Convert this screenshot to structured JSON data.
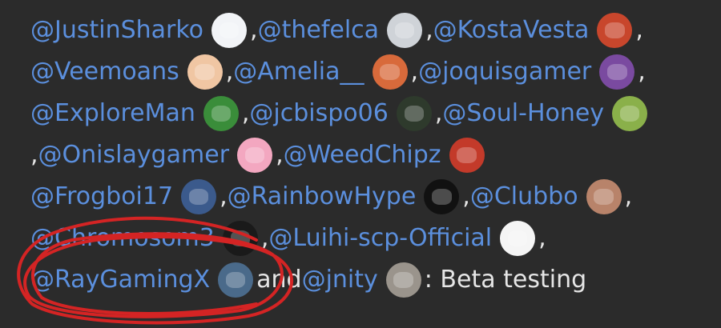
{
  "lines": [
    [
      {
        "type": "mention",
        "text": "@JustinSharko"
      },
      {
        "type": "avatar",
        "name": "avatar-justinsharko",
        "color": "#f2f4f7"
      },
      {
        "type": "sep",
        "text": ", "
      },
      {
        "type": "mention",
        "text": "@thefelca"
      },
      {
        "type": "avatar",
        "name": "avatar-thefelca",
        "color": "#cfd3d8"
      },
      {
        "type": "sep",
        "text": ", "
      },
      {
        "type": "mention",
        "text": "@KostaVesta"
      },
      {
        "type": "avatar",
        "name": "avatar-kostavesta",
        "color": "#c8462c"
      },
      {
        "type": "sep",
        "text": ","
      }
    ],
    [
      {
        "type": "mention",
        "text": "@Veemoans"
      },
      {
        "type": "avatar",
        "name": "avatar-veemoans",
        "color": "#f0c6a3"
      },
      {
        "type": "sep",
        "text": ", "
      },
      {
        "type": "mention",
        "text": "@Amelia__"
      },
      {
        "type": "avatar",
        "name": "avatar-amelia",
        "color": "#d86a3b"
      },
      {
        "type": "sep",
        "text": ", "
      },
      {
        "type": "mention",
        "text": "@joquisgamer"
      },
      {
        "type": "avatar",
        "name": "avatar-joquisgamer",
        "color": "#7a4aa0"
      },
      {
        "type": "sep",
        "text": ","
      }
    ],
    [
      {
        "type": "mention",
        "text": "@ExploreMan"
      },
      {
        "type": "avatar",
        "name": "avatar-exploreman",
        "color": "#3a8d3a"
      },
      {
        "type": "sep",
        "text": ", "
      },
      {
        "type": "mention",
        "text": "@jcbispo06"
      },
      {
        "type": "avatar",
        "name": "avatar-jcbispo06",
        "color": "#2e3a2c"
      },
      {
        "type": "sep",
        "text": ", "
      },
      {
        "type": "mention",
        "text": "@Soul-Honey"
      },
      {
        "type": "avatar",
        "name": "avatar-soul-honey",
        "color": "#8ab04a"
      }
    ],
    [
      {
        "type": "sep",
        "text": ", "
      },
      {
        "type": "mention",
        "text": "@Onislaygamer"
      },
      {
        "type": "avatar",
        "name": "avatar-onislaygamer",
        "color": "#f3a7c0"
      },
      {
        "type": "sep",
        "text": ", "
      },
      {
        "type": "mention",
        "text": "@WeedChipz"
      },
      {
        "type": "avatar",
        "name": "avatar-weedchipz",
        "color": "#c33a2a"
      }
    ],
    [
      {
        "type": "mention",
        "text": "@Frogboi17"
      },
      {
        "type": "avatar",
        "name": "avatar-frogboi17",
        "color": "#3b5a8c"
      },
      {
        "type": "sep",
        "text": ", "
      },
      {
        "type": "mention",
        "text": "@RainbowHype"
      },
      {
        "type": "avatar",
        "name": "avatar-rainbowhype",
        "color": "#111111"
      },
      {
        "type": "sep",
        "text": ", "
      },
      {
        "type": "mention",
        "text": "@Clubbo"
      },
      {
        "type": "avatar",
        "name": "avatar-clubbo",
        "color": "#b8836a"
      },
      {
        "type": "sep",
        "text": ","
      }
    ],
    [
      {
        "type": "mention",
        "text": "@Chromosom3"
      },
      {
        "type": "avatar",
        "name": "avatar-chromosom3",
        "color": "#1a1a1a"
      },
      {
        "type": "sep",
        "text": ", "
      },
      {
        "type": "mention",
        "text": "@Luihi-scp-Official"
      },
      {
        "type": "avatar",
        "name": "avatar-luihi-scp-official",
        "color": "#f5f5f5"
      },
      {
        "type": "sep",
        "text": ","
      }
    ],
    [
      {
        "type": "mention",
        "text": "@RayGamingX"
      },
      {
        "type": "avatar",
        "name": "avatar-raygamingx",
        "color": "#4a6a8a"
      },
      {
        "type": "sep",
        "text": " and "
      },
      {
        "type": "mention",
        "text": "@jnity"
      },
      {
        "type": "avatar",
        "name": "avatar-jnity",
        "color": "#9a948c"
      },
      {
        "type": "txt",
        "text": ": Beta testing"
      }
    ]
  ],
  "annotation": {
    "color": "#d42424"
  }
}
